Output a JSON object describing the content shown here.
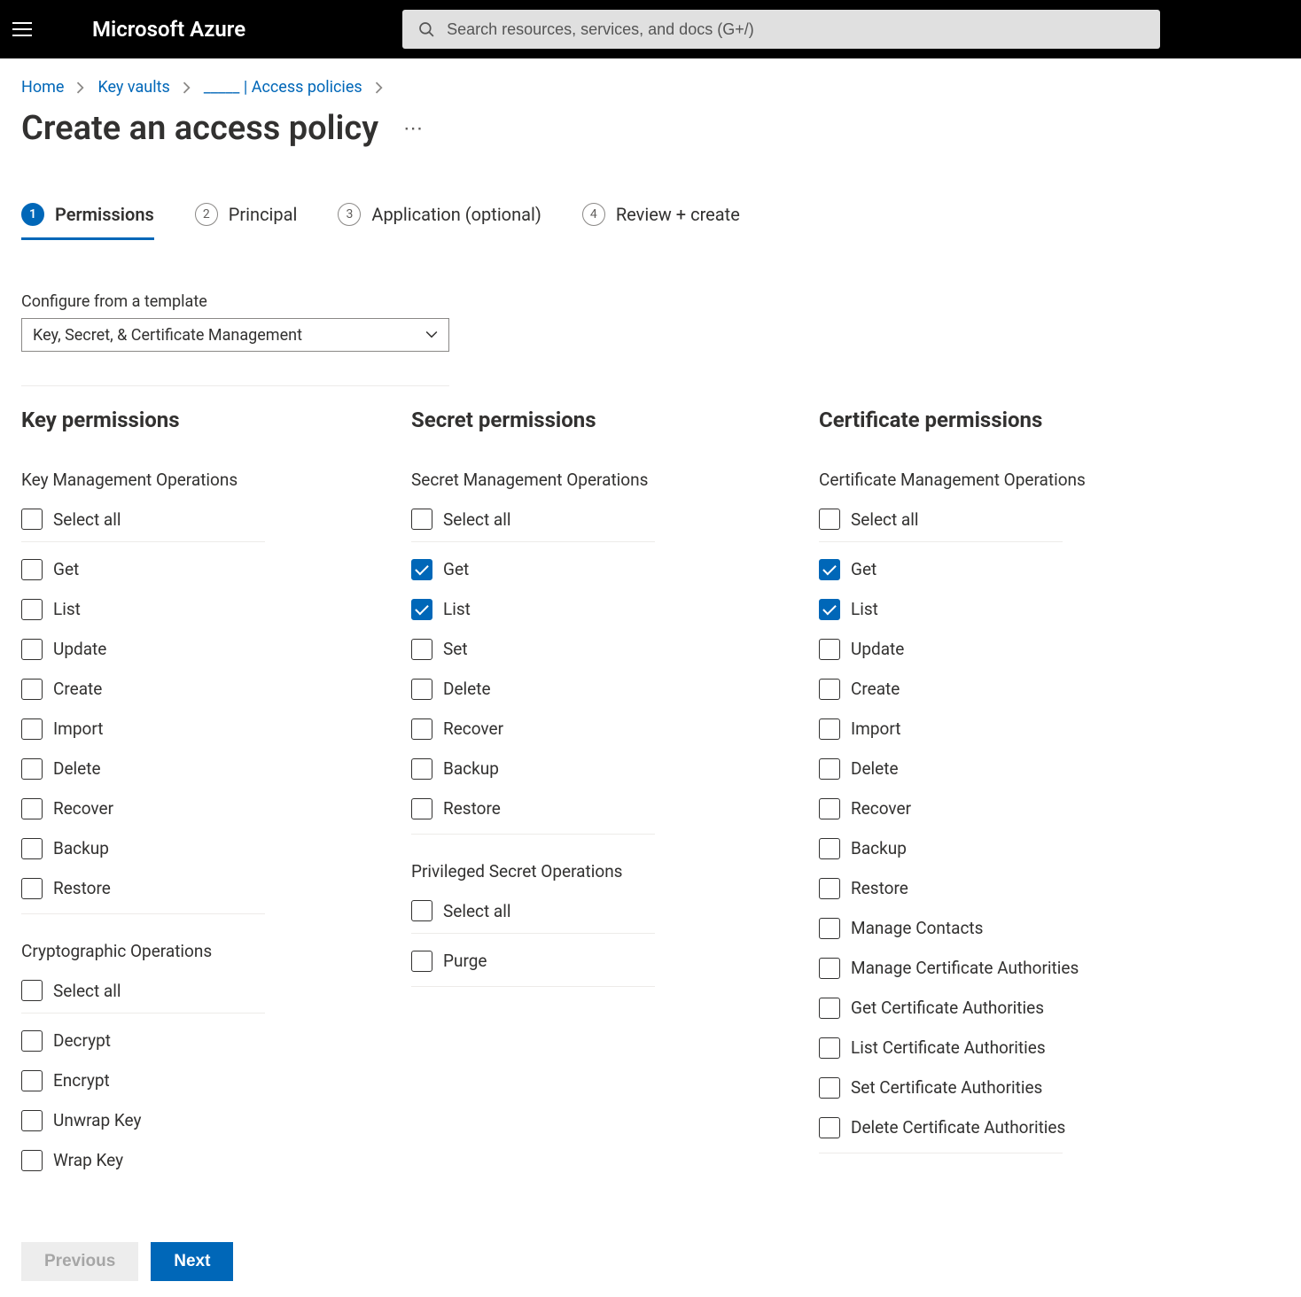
{
  "brand": "Microsoft Azure",
  "search": {
    "placeholder": "Search resources, services, and docs (G+/)"
  },
  "breadcrumb": {
    "items": [
      "Home",
      "Key vaults",
      "_____ | Access policies"
    ]
  },
  "page_title": "Create an access policy",
  "stepper": {
    "steps": [
      {
        "num": "1",
        "label": "Permissions",
        "active": true
      },
      {
        "num": "2",
        "label": "Principal",
        "active": false
      },
      {
        "num": "3",
        "label": "Application (optional)",
        "active": false
      },
      {
        "num": "4",
        "label": "Review + create",
        "active": false
      }
    ]
  },
  "template_label": "Configure from a template",
  "template_value": "Key, Secret, & Certificate Management",
  "select_all_label": "Select all",
  "key": {
    "heading": "Key permissions",
    "groups": [
      {
        "title": "Key Management Operations",
        "items": [
          {
            "label": "Get",
            "checked": false
          },
          {
            "label": "List",
            "checked": false
          },
          {
            "label": "Update",
            "checked": false
          },
          {
            "label": "Create",
            "checked": false
          },
          {
            "label": "Import",
            "checked": false
          },
          {
            "label": "Delete",
            "checked": false
          },
          {
            "label": "Recover",
            "checked": false
          },
          {
            "label": "Backup",
            "checked": false
          },
          {
            "label": "Restore",
            "checked": false
          }
        ]
      },
      {
        "title": "Cryptographic Operations",
        "items": [
          {
            "label": "Decrypt",
            "checked": false
          },
          {
            "label": "Encrypt",
            "checked": false
          },
          {
            "label": "Unwrap Key",
            "checked": false
          },
          {
            "label": "Wrap Key",
            "checked": false
          }
        ]
      }
    ]
  },
  "secret": {
    "heading": "Secret permissions",
    "groups": [
      {
        "title": "Secret Management Operations",
        "items": [
          {
            "label": "Get",
            "checked": true
          },
          {
            "label": "List",
            "checked": true
          },
          {
            "label": "Set",
            "checked": false
          },
          {
            "label": "Delete",
            "checked": false
          },
          {
            "label": "Recover",
            "checked": false
          },
          {
            "label": "Backup",
            "checked": false
          },
          {
            "label": "Restore",
            "checked": false
          }
        ]
      },
      {
        "title": "Privileged Secret Operations",
        "items": [
          {
            "label": "Purge",
            "checked": false
          }
        ]
      }
    ]
  },
  "cert": {
    "heading": "Certificate permissions",
    "groups": [
      {
        "title": "Certificate Management Operations",
        "items": [
          {
            "label": "Get",
            "checked": true
          },
          {
            "label": "List",
            "checked": true
          },
          {
            "label": "Update",
            "checked": false
          },
          {
            "label": "Create",
            "checked": false
          },
          {
            "label": "Import",
            "checked": false
          },
          {
            "label": "Delete",
            "checked": false
          },
          {
            "label": "Recover",
            "checked": false
          },
          {
            "label": "Backup",
            "checked": false
          },
          {
            "label": "Restore",
            "checked": false
          },
          {
            "label": "Manage Contacts",
            "checked": false
          },
          {
            "label": "Manage Certificate Authorities",
            "checked": false
          },
          {
            "label": "Get Certificate Authorities",
            "checked": false
          },
          {
            "label": "List Certificate Authorities",
            "checked": false
          },
          {
            "label": "Set Certificate Authorities",
            "checked": false
          },
          {
            "label": "Delete Certificate Authorities",
            "checked": false
          }
        ]
      }
    ]
  },
  "footer": {
    "previous": "Previous",
    "next": "Next"
  }
}
